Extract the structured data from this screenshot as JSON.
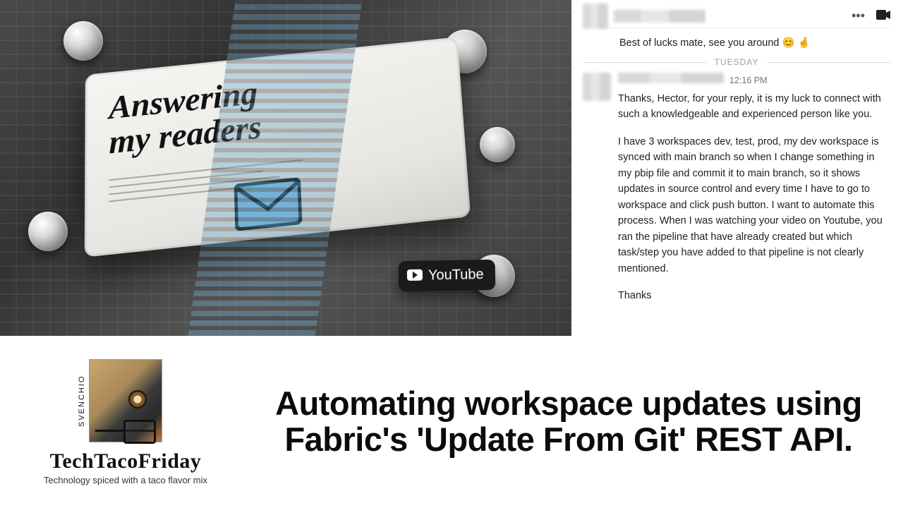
{
  "hero": {
    "panel_title_line1": "Answering",
    "panel_title_line2": "my readers",
    "youtube_label": "YouTube"
  },
  "chat": {
    "msg1": "Best of lucks mate, see you around 😊 🤞",
    "separator": "TUESDAY",
    "timestamp": "12:16 PM",
    "body_p1": "Thanks, Hector, for your reply, it is my luck to connect with such a knowledgeable and experienced person like you.",
    "body_p2": "I have 3 workspaces dev, test, prod, my dev workspace is synced with main branch so when I change something in my pbip file and commit it to main branch, so it shows updates in source control and every time I have to go to workspace and click push button. I want to automate this process. When I was watching your video on Youtube, you ran the pipeline that have already created but which task/step you have added to that pipeline is not clearly mentioned.",
    "body_p3": "Thanks"
  },
  "brand": {
    "side_label": "SVENCHIO",
    "name": "TechTacoFriday",
    "tagline": "Technology spiced with a taco flavor mix"
  },
  "headline": "Automating workspace updates using Fabric's 'Update From Git' REST API."
}
